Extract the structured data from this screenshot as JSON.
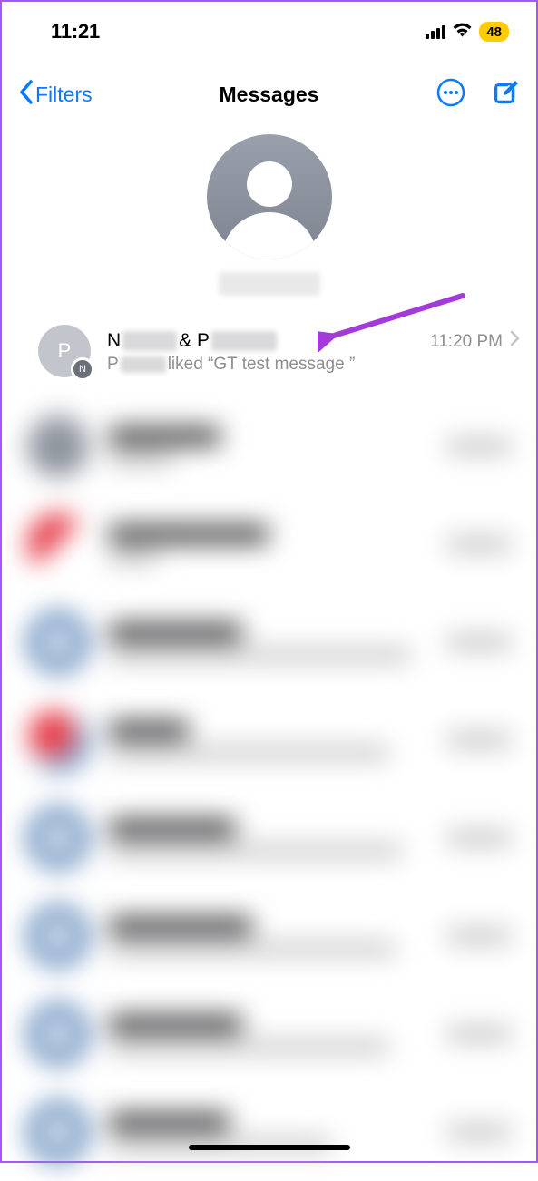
{
  "status": {
    "time": "11:21",
    "battery": "48"
  },
  "nav": {
    "back_label": "Filters",
    "title": "Messages"
  },
  "conversation": {
    "avatar_main": "P",
    "avatar_mini": "N",
    "title_prefix": "N",
    "title_mid": " & P",
    "time": "11:20 PM",
    "sub_prefix": "P",
    "sub_rest": " liked “GT test message ”"
  }
}
